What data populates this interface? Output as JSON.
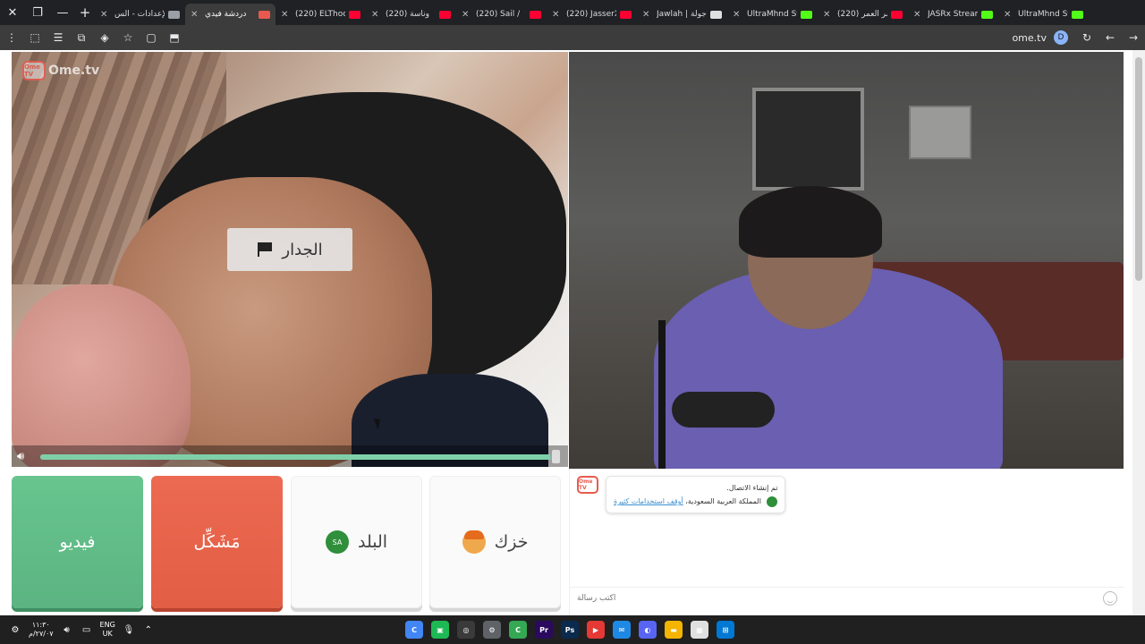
{
  "browser": {
    "tabs": [
      {
        "title": "الإعدادات - الس",
        "favicon_color": "#9aa0a6",
        "active": false
      },
      {
        "title": "دردشة فيدي",
        "favicon_color": "#e85a4f",
        "active": true
      },
      {
        "title": "(220) ELThoob",
        "favicon_color": "#ff0033",
        "active": false
      },
      {
        "title": "(220) وناسة",
        "favicon_color": "#ff0033",
        "active": false
      },
      {
        "title": "(220) Sail /",
        "favicon_color": "#ff0033",
        "active": false
      },
      {
        "title": "(220) JasserX",
        "favicon_color": "#ff0033",
        "active": false
      },
      {
        "title": "Jawlah | جولة",
        "favicon_color": "#e0e0e0",
        "active": false
      },
      {
        "title": "UltraMhnd Stre",
        "favicon_color": "#53fc18",
        "active": false
      },
      {
        "title": "(220) عمر العمر",
        "favicon_color": "#ff0033",
        "active": false
      },
      {
        "title": "JASRx Stream",
        "favicon_color": "#53fc18",
        "active": false
      },
      {
        "title": "UltraMhnd Str",
        "favicon_color": "#53fc18",
        "active": false
      }
    ],
    "url": "ome.tv",
    "profile_initial": "D"
  },
  "app": {
    "logo_badge": "Ome TV",
    "logo_text": "Ome.tv",
    "report_label": "الجدار",
    "volume_percent": 99
  },
  "controls": {
    "video_label": "فيديو",
    "stop_label": "مَشَكِّل",
    "country_label": "البلد",
    "country_flag_text": "SA",
    "gender_label": "خزك"
  },
  "chat": {
    "avatar_text": "Ome TV",
    "line1": "تم إنشاء الاتصال.",
    "line2_link": "أوقف استخدامات كثيرة",
    "line2_text": "المملكة العربية السعودية",
    "input_placeholder": "اكتب رسالة"
  },
  "taskbar": {
    "time": "١١:٣٠",
    "date": "٢٧/٠٧/م",
    "lang_top": "ENG",
    "lang_bottom": "UK",
    "apps": [
      {
        "name": "chrome",
        "color": "#4285f4",
        "glyph": "C"
      },
      {
        "name": "green-app",
        "color": "#1db954",
        "glyph": "▣"
      },
      {
        "name": "obs",
        "color": "#3a3a3a",
        "glyph": "◎"
      },
      {
        "name": "settings",
        "color": "#5f6368",
        "glyph": "⚙"
      },
      {
        "name": "chrome-2",
        "color": "#34a853",
        "glyph": "C"
      },
      {
        "name": "premiere",
        "color": "#2a0a5e",
        "glyph": "Pr"
      },
      {
        "name": "photoshop",
        "color": "#0a2a4e",
        "glyph": "Ps"
      },
      {
        "name": "red-app",
        "color": "#e53935",
        "glyph": "▶"
      },
      {
        "name": "mail",
        "color": "#1e88e5",
        "glyph": "✉"
      },
      {
        "name": "discord",
        "color": "#5865f2",
        "glyph": "◐"
      },
      {
        "name": "files",
        "color": "#f4b400",
        "glyph": "▬"
      },
      {
        "name": "store",
        "color": "#e0e0e0",
        "glyph": "▦"
      },
      {
        "name": "windows",
        "color": "#0078d4",
        "glyph": "⊞"
      }
    ]
  }
}
